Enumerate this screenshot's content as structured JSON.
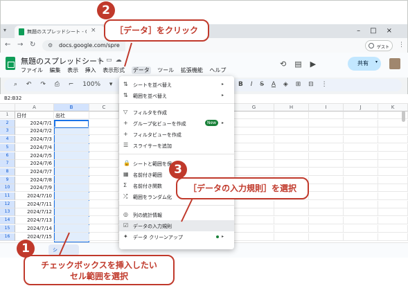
{
  "browser": {
    "tab_title": "無題のスプレッドシート - Google スプ",
    "url": "docs.google.com/spre",
    "guest_label": "ゲスト"
  },
  "sheet": {
    "doc_title": "無題のスプレッドシート",
    "menus": [
      "ファイル",
      "編集",
      "表示",
      "挿入",
      "表示形式",
      "データ",
      "ツール",
      "拡張機能",
      "ヘルプ"
    ],
    "share_label": "共有",
    "zoom": "100%",
    "currency": "¥",
    "percent": "%",
    "name_box": "B2:B32",
    "columns": [
      "A",
      "B",
      "C",
      "G",
      "H",
      "I",
      "J",
      "K"
    ],
    "rows": [
      "1",
      "2",
      "3",
      "4",
      "5",
      "6",
      "7",
      "8",
      "9",
      "10",
      "11",
      "12",
      "13",
      "14",
      "15",
      "16"
    ],
    "header_a": "日付",
    "header_b": "出社",
    "dates": [
      "2024/7/1",
      "2024/7/2",
      "2024/7/3",
      "2024/7/4",
      "2024/7/5",
      "2024/7/6",
      "2024/7/7",
      "2024/7/8",
      "2024/7/9",
      "2024/7/10",
      "2024/7/11",
      "2024/7/12",
      "2024/7/13",
      "2024/7/14",
      "2024/7/15"
    ],
    "sheet_tab": "シ"
  },
  "data_menu": {
    "items": [
      {
        "label": "シートを並べ替え",
        "icon": "sort-icon",
        "submenu": true
      },
      {
        "label": "範囲を並べ替え",
        "icon": "sort-range-icon",
        "submenu": true
      },
      {
        "label": "フィルタを作成",
        "icon": "filter-icon"
      },
      {
        "label": "グループ化ビューを作成",
        "icon": "plus-icon",
        "badge": "New",
        "submenu": true
      },
      {
        "label": "フィルタビューを作成",
        "icon": "plus-icon"
      },
      {
        "label": "スライサーを追加",
        "icon": "slicer-icon"
      },
      {
        "label": "シートと範囲を保",
        "icon": "lock-icon"
      },
      {
        "label": "名前付き範囲",
        "icon": "named-range-icon"
      },
      {
        "label": "名前付き関数",
        "icon": "sigma-icon"
      },
      {
        "label": "範囲をランダム化",
        "icon": "shuffle-icon"
      },
      {
        "label": "列の統計情報",
        "icon": "bulb-icon"
      },
      {
        "label": "データの入力規則",
        "icon": "validation-icon"
      },
      {
        "label": "データ クリーンアップ",
        "icon": "cleanup-icon",
        "submenu": true
      }
    ]
  },
  "callouts": {
    "c1_number": "1",
    "c1_text_line1": "チェックボックスを挿入したい",
    "c1_text_line2": "セル範囲を選択",
    "c2_number": "2",
    "c2_text": "［データ］をクリック",
    "c3_number": "3",
    "c3_text": "［データの入力規則］を選択",
    "color": "#c0392b"
  }
}
